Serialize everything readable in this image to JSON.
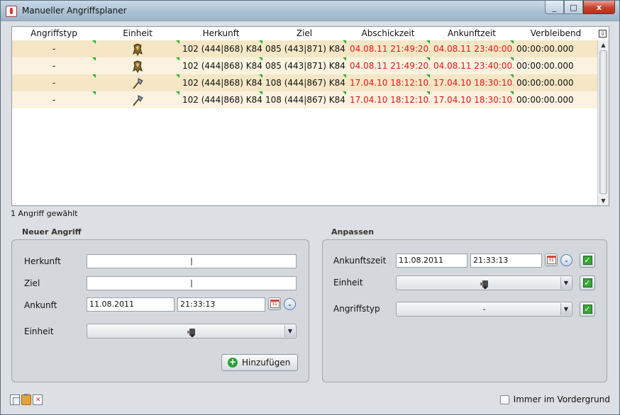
{
  "window": {
    "title": "Manueller Angriffsplaner",
    "min_label": "_",
    "max_label": "□",
    "close_label": "x"
  },
  "table": {
    "columns": [
      "Angriffstyp",
      "Einheit",
      "Herkunft",
      "Ziel",
      "Abschickzeit",
      "Ankunftzeit",
      "Verbleibend"
    ],
    "corner_label": "⇩",
    "rows": [
      {
        "type": "-",
        "unit_icon": "spear-unit-icon",
        "origin": "102 (444|868) K84",
        "target": "085 (443|871) K84",
        "send": "04.08.11 21:49:20...",
        "arrive": "04.08.11 23:40:00...",
        "remaining": "00:00:00.000"
      },
      {
        "type": "-",
        "unit_icon": "spear-unit-icon",
        "origin": "102 (444|868) K84",
        "target": "085 (443|871) K84",
        "send": "04.08.11 21:49:20...",
        "arrive": "04.08.11 23:40:00...",
        "remaining": "00:00:00.000"
      },
      {
        "type": "-",
        "unit_icon": "axe-unit-icon",
        "origin": "102 (444|868) K84",
        "target": "108 (444|867) K84",
        "send": "17.04.10 18:12:10...",
        "arrive": "17.04.10 18:30:10...",
        "remaining": "00:00:00.000"
      },
      {
        "type": "-",
        "unit_icon": "axe-unit-icon",
        "origin": "102 (444|868) K84",
        "target": "108 (444|867) K84",
        "send": "17.04.10 18:12:10...",
        "arrive": "17.04.10 18:30:10...",
        "remaining": "00:00:00.000"
      }
    ]
  },
  "status": "1 Angriff gewählt",
  "new_attack": {
    "title": "Neuer Angriff",
    "origin_label": "Herkunft",
    "origin_value": "|",
    "target_label": "Ziel",
    "target_value": "|",
    "arrival_label": "Ankunft",
    "arrival_date": "11.08.2011",
    "arrival_time": "21:33:13",
    "unit_label": "Einheit",
    "add_label": "Hinzufügen"
  },
  "adjust": {
    "title": "Anpassen",
    "arrival_label": "Ankunftszeit",
    "arrival_date": "11.08.2011",
    "arrival_time": "21:33:13",
    "unit_label": "Einheit",
    "type_label": "Angriffstyp",
    "type_value": "-"
  },
  "footer": {
    "always_on_top_label": "Immer im Vordergrund"
  },
  "icons": {
    "calendar_text": "31",
    "dropdown_glyph": "▼",
    "circle_glyph": "⌄",
    "check_glyph": "✓",
    "plus_glyph": "+"
  }
}
